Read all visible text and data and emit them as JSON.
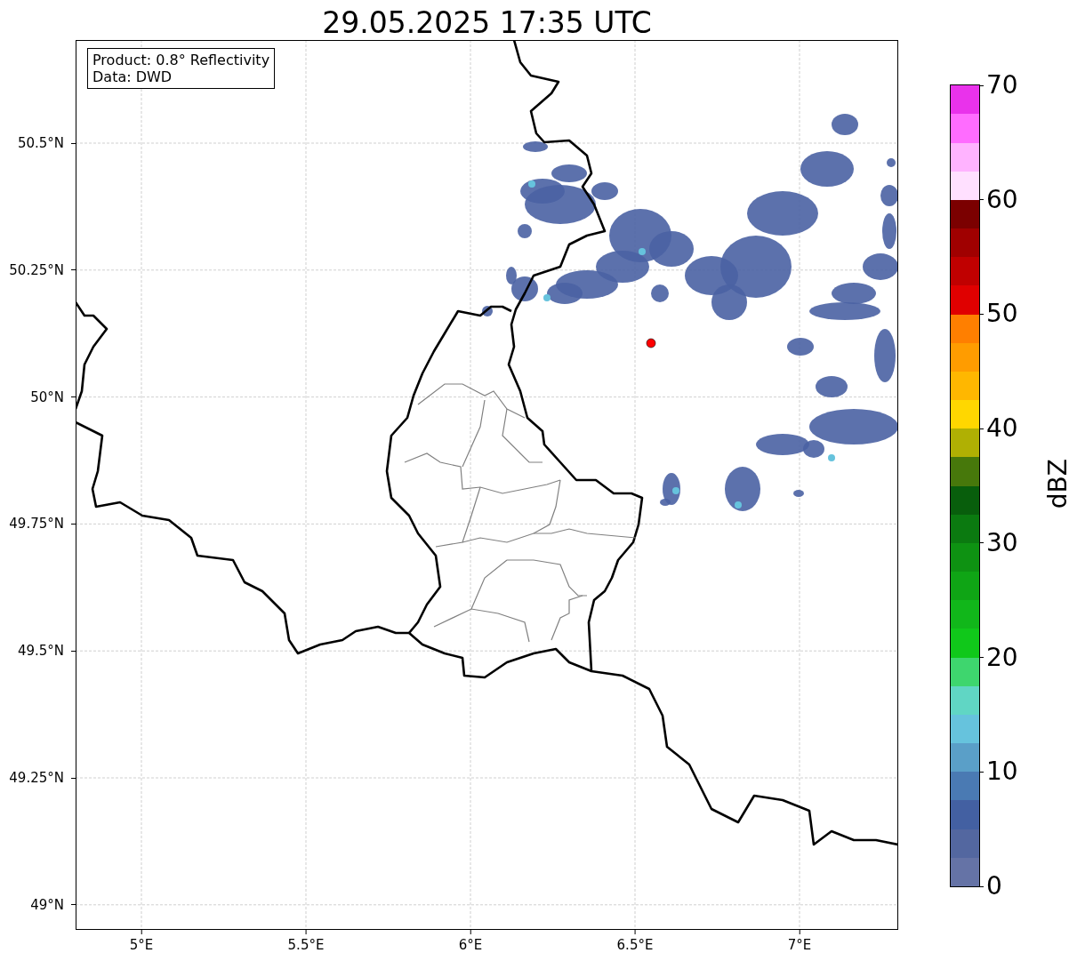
{
  "title": "29.05.2025 17:35 UTC",
  "legend": [
    "Product: 0.8° Reflectivity",
    "Data: DWD"
  ],
  "map": {
    "xticks": [
      "5°E",
      "5.5°E",
      "6°E",
      "6.5°E",
      "7°E"
    ],
    "yticks": [
      "50.5°N",
      "50.25°N",
      "50°N",
      "49.75°N",
      "49.5°N",
      "49.25°N",
      "49°N"
    ]
  },
  "colorbar": {
    "label": "dBZ",
    "ticks": [
      "70",
      "60",
      "50",
      "40",
      "30",
      "20",
      "10",
      "0"
    ],
    "segments": [
      {
        "color": "#6573a6"
      },
      {
        "color": "#5367a0"
      },
      {
        "color": "#4360a2"
      },
      {
        "color": "#4a7ab3"
      },
      {
        "color": "#5a9fc8"
      },
      {
        "color": "#66c3dd"
      },
      {
        "color": "#60d6c4"
      },
      {
        "color": "#3ed66e"
      },
      {
        "color": "#10c81a"
      },
      {
        "color": "#11b71a"
      },
      {
        "color": "#0fa515"
      },
      {
        "color": "#0e9212"
      },
      {
        "color": "#0b7a10"
      },
      {
        "color": "#085e0c"
      },
      {
        "color": "#47780b"
      },
      {
        "color": "#b0b003"
      },
      {
        "color": "#ffd700"
      },
      {
        "color": "#ffb700"
      },
      {
        "color": "#ff9c00"
      },
      {
        "color": "#ff7f00"
      },
      {
        "color": "#e00000"
      },
      {
        "color": "#c00000"
      },
      {
        "color": "#a00000"
      },
      {
        "color": "#7b0000"
      },
      {
        "color": "#ffe0ff"
      },
      {
        "color": "#ffb3ff"
      },
      {
        "color": "#ff6cff"
      },
      {
        "color": "#e932eb"
      }
    ]
  }
}
